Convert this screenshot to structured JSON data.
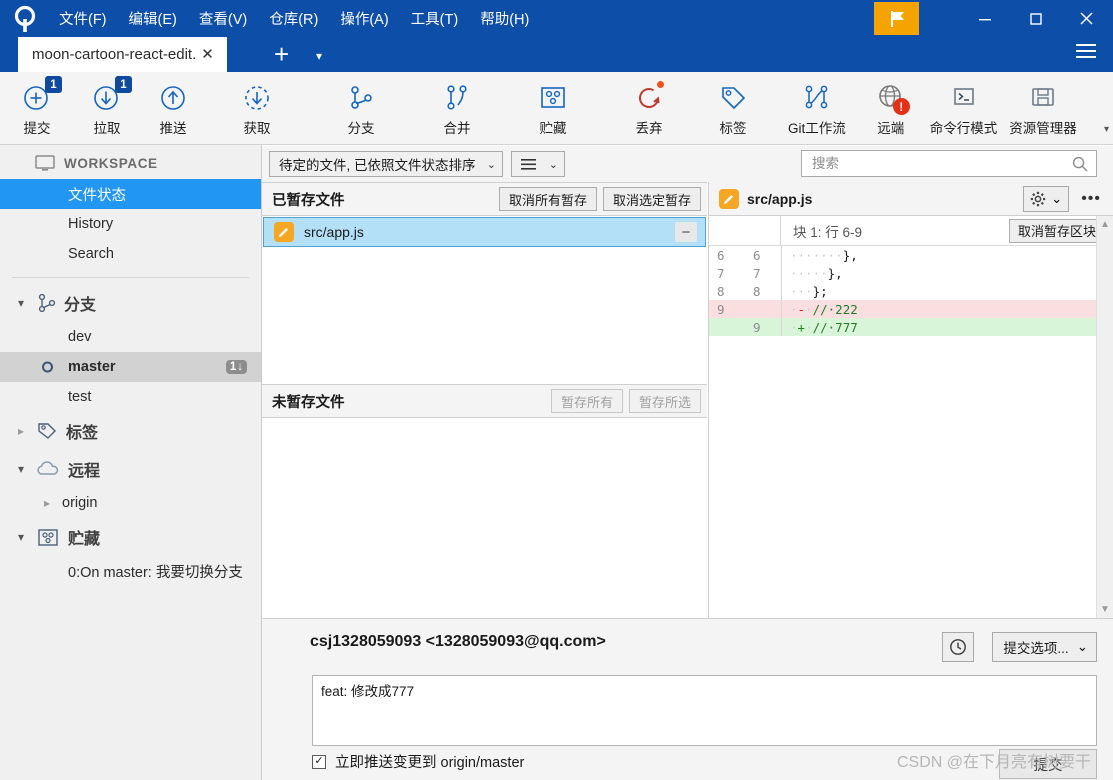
{
  "window": {
    "app_icon": "sourcetree-logo-icon",
    "flag_icon": "flag-icon",
    "minimize_icon": "minimize-icon",
    "maximize_icon": "maximize-icon",
    "close_icon": "close-icon",
    "menu_icon": "hamburger-menu-icon"
  },
  "menubar": [
    {
      "label": "文件(F)"
    },
    {
      "label": "编辑(E)"
    },
    {
      "label": "查看(V)"
    },
    {
      "label": "仓库(R)"
    },
    {
      "label": "操作(A)"
    },
    {
      "label": "工具(T)"
    },
    {
      "label": "帮助(H)"
    }
  ],
  "tabs": {
    "active": "moon-cartoon-react-edit.",
    "close_label": "✕",
    "new_tab_label": "+",
    "dropdown_label": "▾"
  },
  "toolbar": {
    "scroll_more": "▾",
    "items": [
      {
        "label": "提交",
        "icon": "commit-plus-icon",
        "badge": "1"
      },
      {
        "label": "拉取",
        "icon": "pull-down-arrow-icon",
        "badge": "1"
      },
      {
        "label": "推送",
        "icon": "push-up-arrow-icon",
        "badge": ""
      },
      {
        "label": "获取",
        "icon": "fetch-dashed-arrow-icon",
        "badge": ""
      },
      {
        "label": "分支",
        "icon": "branch-icon",
        "badge": ""
      },
      {
        "label": "合并",
        "icon": "merge-icon",
        "badge": ""
      },
      {
        "label": "贮藏",
        "icon": "stash-icon",
        "badge": ""
      },
      {
        "label": "丢弃",
        "icon": "discard-refresh-icon",
        "badge": ""
      },
      {
        "label": "标签",
        "icon": "tag-icon",
        "badge": ""
      },
      {
        "label": "Git工作流",
        "icon": "gitflow-icon",
        "badge": ""
      },
      {
        "label": "远端",
        "icon": "globe-remote-icon",
        "badge": ""
      },
      {
        "label": "命令行模式",
        "icon": "terminal-icon",
        "badge": ""
      },
      {
        "label": "资源管理器",
        "icon": "explorer-folder-icon",
        "badge": ""
      }
    ]
  },
  "sidebar": {
    "workspace": {
      "label": "WORKSPACE",
      "icon": "monitor-icon"
    },
    "workspace_items": [
      {
        "label": "文件状态",
        "selected": true
      },
      {
        "label": "History",
        "selected": false
      },
      {
        "label": "Search",
        "selected": false
      }
    ],
    "branches": {
      "label": "分支",
      "icon": "branch-icon",
      "expanded": true,
      "items": [
        {
          "label": "dev",
          "current": false,
          "badge": ""
        },
        {
          "label": "master",
          "current": true,
          "badge": "1"
        },
        {
          "label": "test",
          "current": false,
          "badge": ""
        }
      ]
    },
    "tags": {
      "label": "标签",
      "icon": "tag-icon",
      "expanded": false
    },
    "remotes": {
      "label": "远程",
      "icon": "cloud-icon",
      "expanded": true,
      "items": [
        {
          "label": "origin"
        }
      ]
    },
    "stashes": {
      "label": "贮藏",
      "icon": "stash-icon",
      "expanded": true,
      "items": [
        {
          "label": "0:On master: 我要切换分支"
        }
      ]
    }
  },
  "filterbar": {
    "filter_value": "待定的文件, 已依照文件状态排序",
    "filter_caret": "⌄",
    "view_icon": "list-view-icon",
    "view_caret": "⌄"
  },
  "search": {
    "placeholder": "搜索",
    "value": "",
    "icon": "search-icon"
  },
  "staged": {
    "title": "已暂存文件",
    "unstage_all_label": "取消所有暂存",
    "unstage_selected_label": "取消选定暂存",
    "files": [
      {
        "name": "src/app.js",
        "status_icon": "modified-pencil-icon",
        "action": "−",
        "selected": true
      }
    ]
  },
  "unstaged": {
    "title": "未暂存文件",
    "stage_all_label": "暂存所有",
    "stage_selected_label": "暂存所选",
    "files": []
  },
  "diff": {
    "file": "src/app.js",
    "file_icon": "modified-pencil-icon",
    "gear_icon": "gear-icon",
    "gear_caret": "⌄",
    "more_icon": "ellipsis-icon",
    "hunk_label": "块 1:  行 6-9",
    "unstage_hunk_label": "取消暂存区块",
    "lines": [
      {
        "old": "6",
        "new": "6",
        "marker": "",
        "ws": "·······",
        "text": "},",
        "type": "ctx"
      },
      {
        "old": "7",
        "new": "7",
        "marker": "",
        "ws": "·····",
        "text": "},",
        "type": "ctx"
      },
      {
        "old": "8",
        "new": "8",
        "marker": "",
        "ws": "···",
        "text": "};",
        "type": "ctx"
      },
      {
        "old": "9",
        "new": "",
        "marker": "-",
        "ws": "·",
        "text": "//·222",
        "type": "del"
      },
      {
        "old": "",
        "new": "9",
        "marker": "+",
        "ws": "·",
        "text": "//·777",
        "type": "add"
      }
    ]
  },
  "commit": {
    "author": "csj1328059093 <1328059093@qq.com>",
    "history_icon": "clock-history-icon",
    "options_label": "提交选项...",
    "options_caret": "⌄",
    "message": "feat: 修改成777",
    "message_placeholder": "",
    "push_checkbox_label": "立即推送变更到 origin/master",
    "push_checked": true,
    "check_glyph": "✓",
    "commit_button_label": "提交"
  },
  "watermark": "CSDN @在下月亮有树要干",
  "colors": {
    "titlebar": "#0d4ea8",
    "accent_selected": "#2196f3",
    "flag_orange": "#f5a300",
    "badge_blue": "#104a9e",
    "diff_add": "#d9f5d9",
    "diff_del": "#fbdfe0",
    "file_icon_orange": "#f5a623"
  }
}
